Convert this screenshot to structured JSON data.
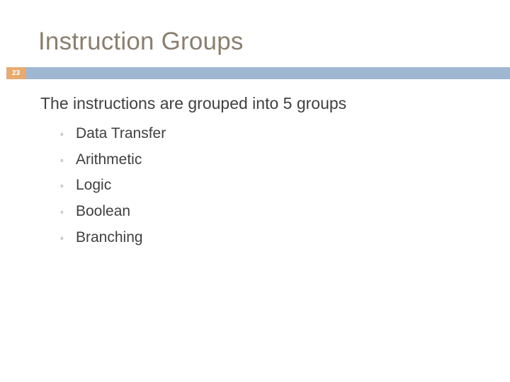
{
  "slide": {
    "title": "Instruction Groups",
    "number": "23",
    "lead_line": "The instructions are grouped into 5 groups",
    "bullet_marker": "◦",
    "bullets": [
      {
        "label": "Data Transfer"
      },
      {
        "label": "Arithmetic"
      },
      {
        "label": "Logic"
      },
      {
        "label": "Boolean"
      },
      {
        "label": "Branching"
      }
    ],
    "colors": {
      "title": "#8a7f6e",
      "divider": "#9fb8d2",
      "number_badge": "#e8ab6f",
      "body_text": "#404040"
    }
  }
}
